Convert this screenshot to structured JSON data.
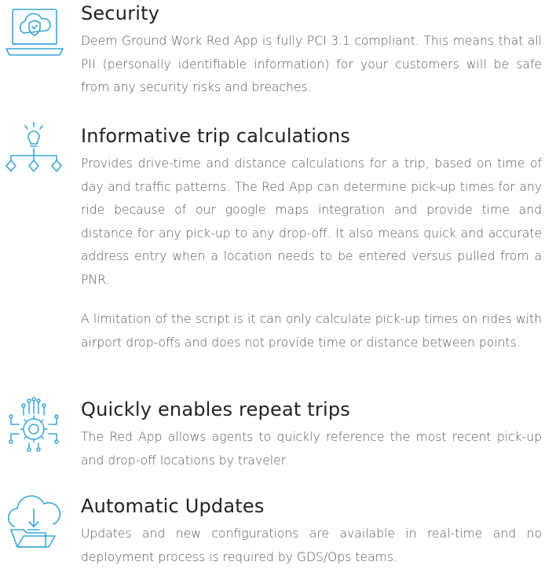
{
  "features": [
    {
      "icon": "cloud-shield-laptop-icon",
      "title": "Security",
      "paragraphs": [
        "Deem Ground Work Red App is fully PCI 3.1 compliant. This means that all PII (personally identifiable information) for your customers will be safe from any security risks and breaches."
      ]
    },
    {
      "icon": "lightbulb-flowchart-icon",
      "title": "Informative trip calculations",
      "paragraphs": [
        "Provides drive-time and distance calculations for a trip, based on time of day and traffic patterns. The Red App can determine pick-up times for any ride because of our google maps integration and provide time and distance for any pick-up to any drop-off. It also means quick and accurate address entry when a location needs to be entered versus pulled from a PNR.",
        "A limitation of the script is it can only calculate pick-up times on rides with airport drop-offs and does not provide time or distance between points."
      ]
    },
    {
      "icon": "gear-circuit-icon",
      "title": "Quickly enables repeat trips",
      "paragraphs": [
        "The Red App allows agents to quickly reference the most recent pick-up and drop-off locations by traveler."
      ]
    },
    {
      "icon": "cloud-download-folder-icon",
      "title": "Automatic Updates",
      "paragraphs": [
        "Updates and new configurations are available in real-time and no deployment process is required by GDS/Ops teams."
      ]
    }
  ],
  "colors": {
    "icon": "#3aa6d8",
    "heading": "#222222",
    "body": "#575757"
  }
}
